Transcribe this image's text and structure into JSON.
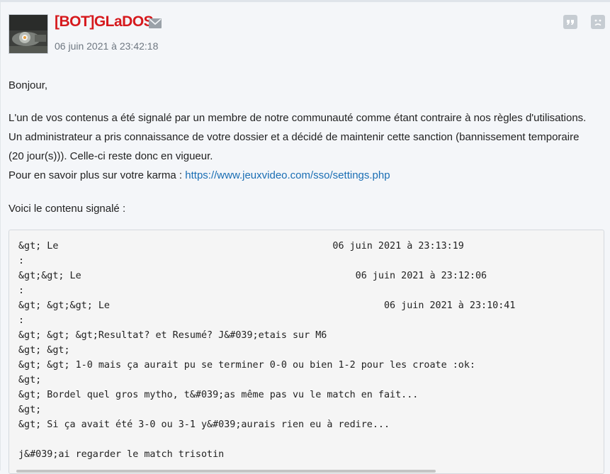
{
  "post": {
    "author": "[BOT]GLaDOS",
    "date": "06 juin 2021 à 23:42:18",
    "icons": {
      "avatar": "robot-avatar",
      "mail": "envelope-icon",
      "quote": "quote-icon",
      "report": "sad-face-report-icon"
    },
    "colors": {
      "author": "#d6191d",
      "link": "#1a6eb4"
    }
  },
  "message": {
    "greeting": "Bonjour,",
    "body_line1": "L'un de vos contenus a été signalé par un membre de notre communauté comme étant contraire à nos règles d'utilisations.",
    "body_line2": "Un administrateur a pris connaissance de votre dossier et a décidé de maintenir cette sanction (bannissement temporaire (20 jour(s))). Celle-ci reste donc en vigueur.",
    "karma_prefix": "Pour en savoir plus sur votre karma : ",
    "karma_link": "https://www.jeuxvideo.com/sso/settings.php",
    "reported_intro": "Voici le contenu signalé :"
  },
  "quote": {
    "lines": [
      "&gt; Le                                                06 juin 2021 à 23:13:19",
      ":",
      "&gt;&gt; Le                                                06 juin 2021 à 23:12:06",
      ":",
      "&gt; &gt;&gt; Le                                                06 juin 2021 à 23:10:41",
      ":",
      "&gt; &gt; &gt;Resultat? et Resumé? J&#039;etais sur M6",
      "&gt; &gt;",
      "&gt; &gt; 1-0 mais ça aurait pu se terminer 0-0 ou bien 1-2 pour les croate :ok:",
      "&gt;",
      "&gt; Bordel quel gros mytho, t&#039;as même pas vu le match en fait...",
      "&gt;",
      "&gt; Si ça avait été 3-0 ou 3-1 y&#039;aurais rien eu à redire...",
      "",
      "j&#039;ai regarder le match trisotin"
    ]
  }
}
